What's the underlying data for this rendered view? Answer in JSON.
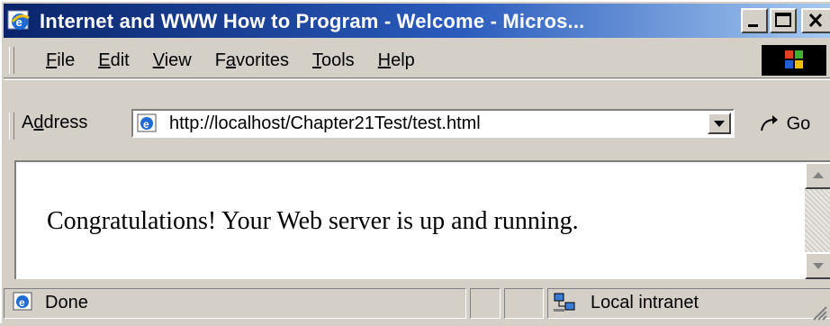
{
  "window": {
    "title": "Internet and WWW How to Program - Welcome - Micros..."
  },
  "menu": {
    "items": [
      {
        "label": "File",
        "accesskey": "F",
        "rest": "ile"
      },
      {
        "label": "Edit",
        "accesskey": "E",
        "rest": "dit"
      },
      {
        "label": "View",
        "accesskey": "V",
        "rest": "iew"
      },
      {
        "label": "Favorites",
        "prefix": "F",
        "accesskey": "a",
        "rest": "vorites"
      },
      {
        "label": "Tools",
        "accesskey": "T",
        "rest": "ools"
      },
      {
        "label": "Help",
        "accesskey": "H",
        "rest": "elp"
      }
    ]
  },
  "address": {
    "label_prefix": "A",
    "label_accesskey": "d",
    "label_rest": "dress",
    "url": "http://localhost/Chapter21Test/test.html",
    "go_label": "Go"
  },
  "content": {
    "message": "Congratulations! Your Web server is up and running."
  },
  "status": {
    "text": "Done",
    "zone": "Local intranet"
  },
  "icons": {
    "title": "ie-icon",
    "address": "ie-page-icon",
    "go": "go-arrow-icon",
    "status": "ie-page-icon",
    "zone": "local-intranet-icon"
  }
}
